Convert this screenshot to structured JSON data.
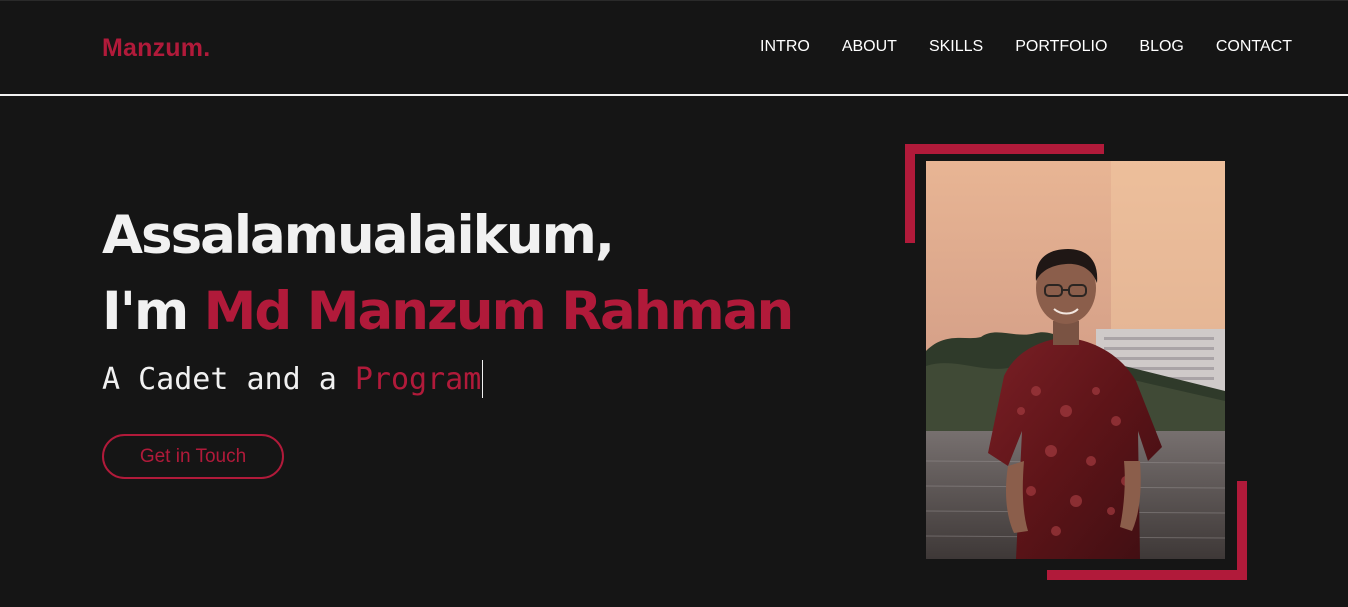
{
  "brand": {
    "name": "Manzum."
  },
  "nav": {
    "items": [
      {
        "label": "INTRO"
      },
      {
        "label": "ABOUT"
      },
      {
        "label": "SKILLS"
      },
      {
        "label": "PORTFOLIO"
      },
      {
        "label": "BLOG"
      },
      {
        "label": "CONTACT"
      }
    ]
  },
  "hero": {
    "greeting": "Assalamualaikum,",
    "intro_prefix": "I'm",
    "name": "Md Manzum Rahman",
    "typed_static": "A Cadet and a",
    "typed_dynamic": "Program",
    "cta_label": "Get in Touch"
  },
  "colors": {
    "background": "#151515",
    "accent": "#b11a3a",
    "text": "#f1f1f1"
  }
}
